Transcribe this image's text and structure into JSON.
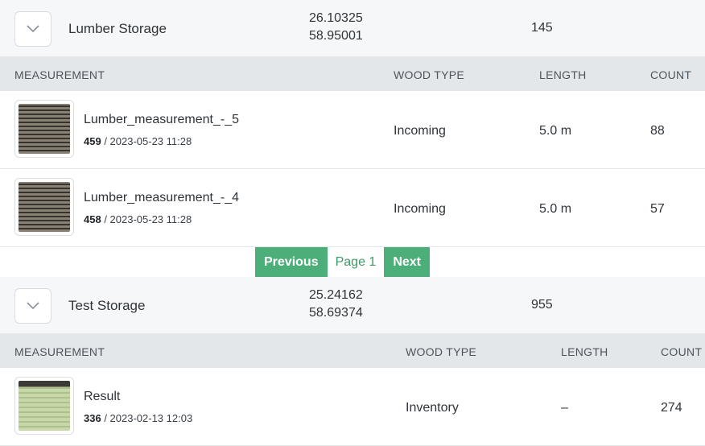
{
  "storages": [
    {
      "name": "Lumber Storage",
      "lat": "26.10325",
      "lon": "58.95001",
      "count": "145",
      "headers": {
        "measurement": "MEASUREMENT",
        "wood_type": "WOOD TYPE",
        "length": "LENGTH",
        "count": "COUNT"
      },
      "rows": [
        {
          "name": "Lumber_measurement_-_5",
          "id": "459",
          "date": " / 2023-05-23 11:28",
          "wood_type": "Incoming",
          "length": "5.0 m",
          "count": "88"
        },
        {
          "name": "Lumber_measurement_-_4",
          "id": "458",
          "date": " / 2023-05-23 11:28",
          "wood_type": "Incoming",
          "length": "5.0 m",
          "count": "57"
        }
      ],
      "pager": {
        "previous": "Previous",
        "page": "Page 1",
        "next": "Next"
      }
    },
    {
      "name": "Test Storage",
      "lat": "25.24162",
      "lon": "58.69374",
      "count": "955",
      "headers": {
        "measurement": "MEASUREMENT",
        "wood_type": "WOOD TYPE",
        "length": "LENGTH",
        "count": "COUNT"
      },
      "rows": [
        {
          "name": "Result",
          "id": "336",
          "date": " / 2023-02-13 12:03",
          "wood_type": "Inventory",
          "length": "–",
          "count": "274"
        }
      ]
    }
  ],
  "icons": {
    "expand": "chevron-down-icon"
  },
  "colors": {
    "accent": "#4caf7a",
    "accent_text": "#3c9a64",
    "header_bg": "#e4e7ea"
  }
}
